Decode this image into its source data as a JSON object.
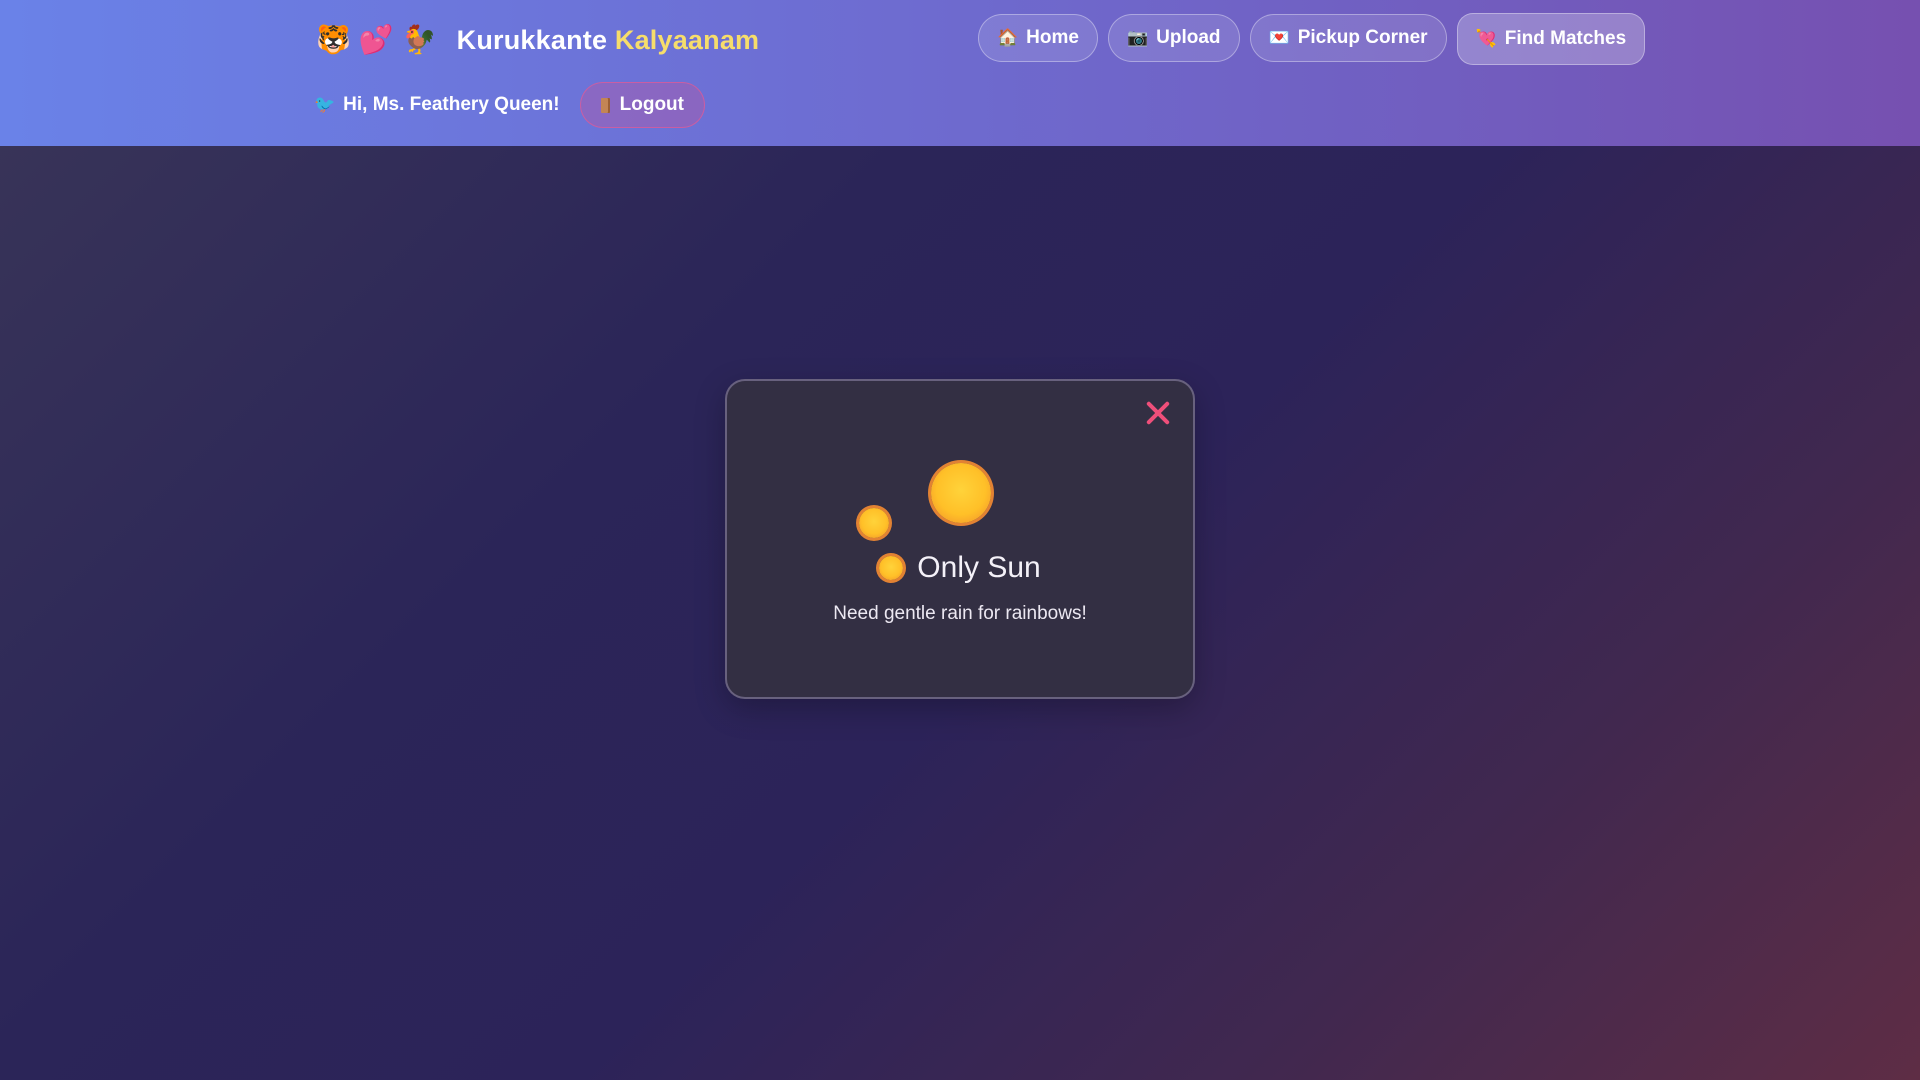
{
  "header": {
    "brand_emojis": [
      "🐯",
      "💕",
      "🐓"
    ],
    "brand_first": "Kurukkante",
    "brand_second": "Kalyaanam",
    "nav": [
      {
        "icon": "🏠",
        "icon_name": "home-icon",
        "label": "Home"
      },
      {
        "icon": "📷",
        "icon_name": "camera-icon",
        "label": "Upload"
      },
      {
        "icon": "💌",
        "icon_name": "love-letter-icon",
        "label": "Pickup Corner"
      },
      {
        "icon": "💘",
        "icon_name": "heart-arrow-icon",
        "label": "Find Matches",
        "active": true
      }
    ],
    "user_icon": "🐦",
    "greeting": "Hi, Ms. Feathery Queen!",
    "logout_label": "Logout"
  },
  "modal": {
    "title": "Only Sun",
    "message": "Need gentle rain for rainbows!",
    "close_icon": "close-icon"
  },
  "colors": {
    "header_start": "#6a82e8",
    "header_end": "#7650b0",
    "brand_accent": "#f6dd6b",
    "close": "#ef4f7a",
    "sun": "#ffc028"
  }
}
